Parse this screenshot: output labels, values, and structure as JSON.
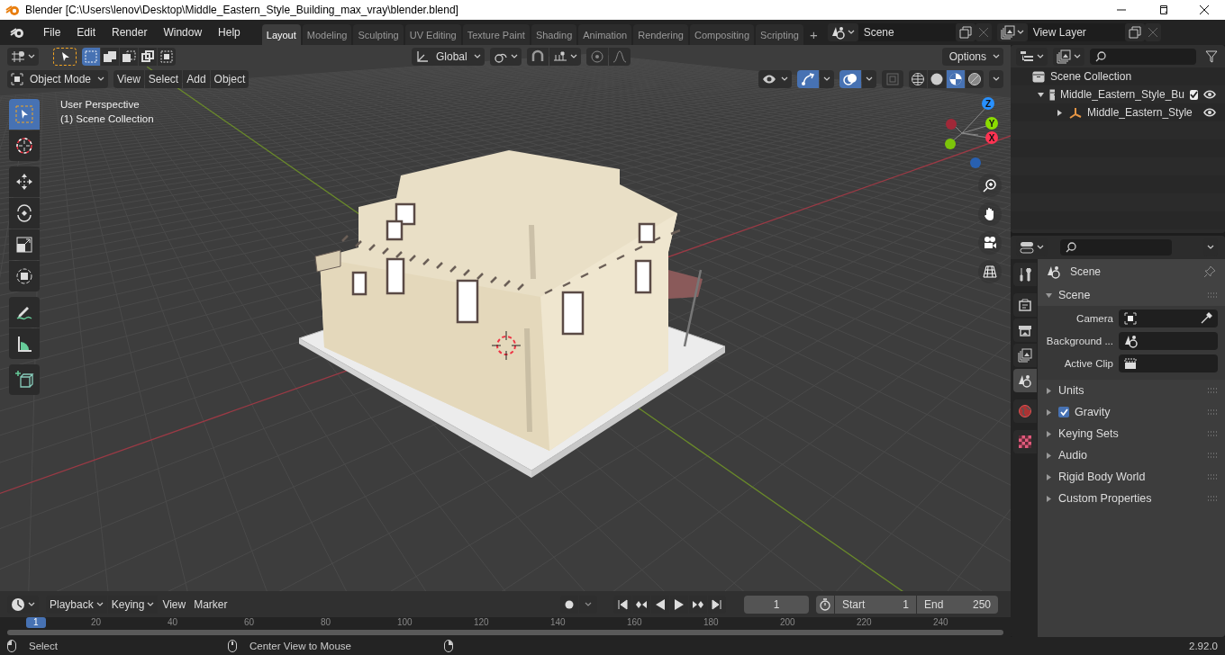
{
  "window": {
    "title": "Blender [C:\\Users\\lenov\\Desktop\\Middle_Eastern_Style_Building_max_vray\\blender.blend]"
  },
  "menu": [
    "File",
    "Edit",
    "Render",
    "Window",
    "Help"
  ],
  "workspaces": [
    {
      "label": "Layout",
      "selected": true
    },
    {
      "label": "Modeling",
      "selected": false
    },
    {
      "label": "Sculpting",
      "selected": false
    },
    {
      "label": "UV Editing",
      "selected": false
    },
    {
      "label": "Texture Paint",
      "selected": false
    },
    {
      "label": "Shading",
      "selected": false
    },
    {
      "label": "Animation",
      "selected": false
    },
    {
      "label": "Rendering",
      "selected": false
    },
    {
      "label": "Compositing",
      "selected": false
    },
    {
      "label": "Scripting",
      "selected": false
    }
  ],
  "add_workspace": "+",
  "scene_field": "Scene",
  "view_layer_field": "View Layer",
  "tool_header": {
    "select_modes": [
      {
        "kind": "set",
        "selected": true
      },
      {
        "kind": "extend",
        "selected": false
      },
      {
        "kind": "subtract",
        "selected": false
      },
      {
        "kind": "invert",
        "selected": false
      },
      {
        "kind": "intersect",
        "selected": false
      }
    ],
    "orientation": "Global",
    "snap_on": false,
    "proportional_on": false,
    "options": "Options"
  },
  "viewport_header": {
    "mode": "Object Mode",
    "menus": [
      "View",
      "Select",
      "Add",
      "Object"
    ],
    "toggles": [
      {
        "kind": "gizmos",
        "on": true
      },
      {
        "kind": "overlays",
        "on": true
      },
      {
        "kind": "xray",
        "on": false
      }
    ],
    "shading": [
      {
        "kind": "wireframe",
        "selected": false
      },
      {
        "kind": "solid",
        "selected": false
      },
      {
        "kind": "material",
        "selected": true
      },
      {
        "kind": "rendered",
        "selected": false
      }
    ]
  },
  "viewport": {
    "view_name": "User Perspective",
    "collection": "(1) Scene Collection",
    "axes": [
      {
        "label": "Z",
        "kind": "z"
      },
      {
        "label": "Y",
        "kind": "y"
      },
      {
        "label": "X",
        "kind": "x"
      }
    ]
  },
  "tools": [
    {
      "items": [
        {
          "kind": "select",
          "selected": true
        },
        {
          "kind": "cursor",
          "selected": false
        }
      ]
    },
    {
      "items": [
        {
          "kind": "move",
          "selected": false
        },
        {
          "kind": "rotate",
          "selected": false
        },
        {
          "kind": "scale",
          "selected": false
        },
        {
          "kind": "transform",
          "selected": false
        }
      ]
    },
    {
      "items": [
        {
          "kind": "annotate",
          "selected": false
        },
        {
          "kind": "measure",
          "selected": false
        }
      ]
    },
    {
      "items": [
        {
          "kind": "add_cube",
          "selected": false
        }
      ]
    }
  ],
  "outliner": {
    "root": "Scene Collection",
    "items": [
      {
        "label": "Middle_Eastern_Style_Bu",
        "kind": "collection",
        "expanded": true,
        "checked": true,
        "visible": true,
        "children": [
          {
            "label": "Middle_Eastern_Style",
            "kind": "empty",
            "expanded": false,
            "visible": true
          }
        ]
      }
    ]
  },
  "properties": {
    "tabs": [
      {
        "kind": "tool",
        "selected": false
      },
      {
        "kind": "render",
        "selected": false
      },
      {
        "kind": "output",
        "selected": false
      },
      {
        "kind": "view_layer",
        "selected": false
      },
      {
        "kind": "scene",
        "selected": true
      },
      {
        "kind": "world",
        "selected": false
      },
      {
        "kind": "texture",
        "selected": false
      }
    ],
    "context": "Scene",
    "panels": [
      {
        "label": "Scene",
        "kind": "plain",
        "expanded": true,
        "fields": [
          {
            "label": "Camera",
            "kind": "camera"
          },
          {
            "label": "Background ...",
            "kind": "scene"
          },
          {
            "label": "Active Clip",
            "kind": "clip"
          }
        ]
      },
      {
        "label": "Units",
        "kind": "plain",
        "expanded": false
      },
      {
        "label": "Gravity",
        "kind": "toggle",
        "checked": true,
        "expanded": false
      },
      {
        "label": "Keying Sets",
        "kind": "plain",
        "expanded": false
      },
      {
        "label": "Audio",
        "kind": "plain",
        "expanded": false
      },
      {
        "label": "Rigid Body World",
        "kind": "plain",
        "expanded": false
      },
      {
        "label": "Custom Properties",
        "kind": "plain",
        "expanded": false
      }
    ]
  },
  "timeline": {
    "menus": [
      {
        "label": "Playback",
        "kind": "dropdown"
      },
      {
        "label": "Keying",
        "kind": "dropdown"
      },
      {
        "label": "View",
        "kind": "plain"
      },
      {
        "label": "Marker",
        "kind": "plain"
      }
    ],
    "auto_key": false,
    "current_frame": "1",
    "start_label": "Start",
    "start": "1",
    "end_label": "End",
    "end": "250",
    "playhead": "1",
    "ticks": [
      "20",
      "40",
      "60",
      "80",
      "100",
      "120",
      "140",
      "160",
      "180",
      "200",
      "220",
      "240"
    ]
  },
  "status_bar": {
    "hints": [
      {
        "label": "Select",
        "kind": "left"
      },
      {
        "label": "Center View to Mouse",
        "kind": "middle"
      },
      {
        "kind": "right"
      }
    ],
    "version": "2.92.0"
  }
}
